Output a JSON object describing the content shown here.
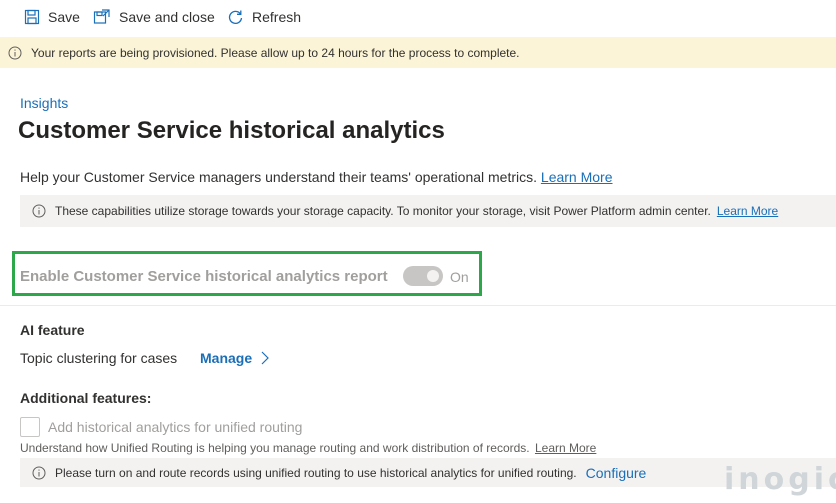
{
  "toolbar": {
    "save_label": "Save",
    "save_close_label": "Save and close",
    "refresh_label": "Refresh"
  },
  "banner": {
    "message": "Your reports are being provisioned. Please allow up to 24 hours for the process to complete."
  },
  "breadcrumb": "Insights",
  "page_title": "Customer Service historical analytics",
  "help": {
    "text": "Help your Customer Service managers understand their teams' operational metrics.",
    "link": "Learn More"
  },
  "storage_notice": {
    "text": "These capabilities utilize storage towards your storage capacity. To monitor your storage, visit Power Platform admin center.",
    "link": "Learn More"
  },
  "enable_report": {
    "label": "Enable Customer Service historical analytics report",
    "state": "On",
    "enabled": true
  },
  "ai_feature": {
    "heading": "AI feature",
    "topic_label": "Topic clustering for cases",
    "manage_link": "Manage"
  },
  "additional": {
    "heading": "Additional features:",
    "checkbox_label": "Add historical analytics for unified routing",
    "checked": false,
    "help_text": "Understand how Unified Routing is helping you manage routing and work distribution of records.",
    "help_link": "Learn More"
  },
  "routing_notice": {
    "text": "Please turn on and route records using unified routing to use historical analytics for unified routing.",
    "configure_link": "Configure"
  },
  "watermark": "inogic",
  "colors": {
    "accent": "#1a6fb8",
    "banner_bg": "#fcf4d6",
    "highlight": "#2ca84a",
    "disabled_text": "#a19f9d"
  }
}
